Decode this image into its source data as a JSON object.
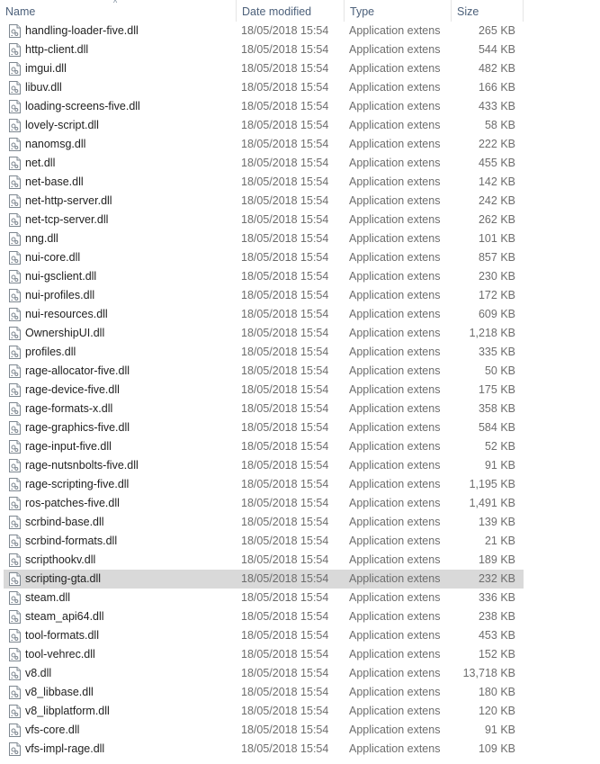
{
  "columns": {
    "name": "Name",
    "date": "Date modified",
    "type": "Type",
    "size": "Size"
  },
  "sort_indicator": "^",
  "icon": "dll-file-icon",
  "selected_index": 29,
  "files": [
    {
      "name": "handling-loader-five.dll",
      "date": "18/05/2018 15:54",
      "type": "Application extens",
      "size": "265 KB"
    },
    {
      "name": "http-client.dll",
      "date": "18/05/2018 15:54",
      "type": "Application extens",
      "size": "544 KB"
    },
    {
      "name": "imgui.dll",
      "date": "18/05/2018 15:54",
      "type": "Application extens",
      "size": "482 KB"
    },
    {
      "name": "libuv.dll",
      "date": "18/05/2018 15:54",
      "type": "Application extens",
      "size": "166 KB"
    },
    {
      "name": "loading-screens-five.dll",
      "date": "18/05/2018 15:54",
      "type": "Application extens",
      "size": "433 KB"
    },
    {
      "name": "lovely-script.dll",
      "date": "18/05/2018 15:54",
      "type": "Application extens",
      "size": "58 KB"
    },
    {
      "name": "nanomsg.dll",
      "date": "18/05/2018 15:54",
      "type": "Application extens",
      "size": "222 KB"
    },
    {
      "name": "net.dll",
      "date": "18/05/2018 15:54",
      "type": "Application extens",
      "size": "455 KB"
    },
    {
      "name": "net-base.dll",
      "date": "18/05/2018 15:54",
      "type": "Application extens",
      "size": "142 KB"
    },
    {
      "name": "net-http-server.dll",
      "date": "18/05/2018 15:54",
      "type": "Application extens",
      "size": "242 KB"
    },
    {
      "name": "net-tcp-server.dll",
      "date": "18/05/2018 15:54",
      "type": "Application extens",
      "size": "262 KB"
    },
    {
      "name": "nng.dll",
      "date": "18/05/2018 15:54",
      "type": "Application extens",
      "size": "101 KB"
    },
    {
      "name": "nui-core.dll",
      "date": "18/05/2018 15:54",
      "type": "Application extens",
      "size": "857 KB"
    },
    {
      "name": "nui-gsclient.dll",
      "date": "18/05/2018 15:54",
      "type": "Application extens",
      "size": "230 KB"
    },
    {
      "name": "nui-profiles.dll",
      "date": "18/05/2018 15:54",
      "type": "Application extens",
      "size": "172 KB"
    },
    {
      "name": "nui-resources.dll",
      "date": "18/05/2018 15:54",
      "type": "Application extens",
      "size": "609 KB"
    },
    {
      "name": "OwnershipUI.dll",
      "date": "18/05/2018 15:54",
      "type": "Application extens",
      "size": "1,218 KB"
    },
    {
      "name": "profiles.dll",
      "date": "18/05/2018 15:54",
      "type": "Application extens",
      "size": "335 KB"
    },
    {
      "name": "rage-allocator-five.dll",
      "date": "18/05/2018 15:54",
      "type": "Application extens",
      "size": "50 KB"
    },
    {
      "name": "rage-device-five.dll",
      "date": "18/05/2018 15:54",
      "type": "Application extens",
      "size": "175 KB"
    },
    {
      "name": "rage-formats-x.dll",
      "date": "18/05/2018 15:54",
      "type": "Application extens",
      "size": "358 KB"
    },
    {
      "name": "rage-graphics-five.dll",
      "date": "18/05/2018 15:54",
      "type": "Application extens",
      "size": "584 KB"
    },
    {
      "name": "rage-input-five.dll",
      "date": "18/05/2018 15:54",
      "type": "Application extens",
      "size": "52 KB"
    },
    {
      "name": "rage-nutsnbolts-five.dll",
      "date": "18/05/2018 15:54",
      "type": "Application extens",
      "size": "91 KB"
    },
    {
      "name": "rage-scripting-five.dll",
      "date": "18/05/2018 15:54",
      "type": "Application extens",
      "size": "1,195 KB"
    },
    {
      "name": "ros-patches-five.dll",
      "date": "18/05/2018 15:54",
      "type": "Application extens",
      "size": "1,491 KB"
    },
    {
      "name": "scrbind-base.dll",
      "date": "18/05/2018 15:54",
      "type": "Application extens",
      "size": "139 KB"
    },
    {
      "name": "scrbind-formats.dll",
      "date": "18/05/2018 15:54",
      "type": "Application extens",
      "size": "21 KB"
    },
    {
      "name": "scripthookv.dll",
      "date": "18/05/2018 15:54",
      "type": "Application extens",
      "size": "189 KB"
    },
    {
      "name": "scripting-gta.dll",
      "date": "18/05/2018 15:54",
      "type": "Application extens",
      "size": "232 KB"
    },
    {
      "name": "steam.dll",
      "date": "18/05/2018 15:54",
      "type": "Application extens",
      "size": "336 KB"
    },
    {
      "name": "steam_api64.dll",
      "date": "18/05/2018 15:54",
      "type": "Application extens",
      "size": "238 KB"
    },
    {
      "name": "tool-formats.dll",
      "date": "18/05/2018 15:54",
      "type": "Application extens",
      "size": "453 KB"
    },
    {
      "name": "tool-vehrec.dll",
      "date": "18/05/2018 15:54",
      "type": "Application extens",
      "size": "152 KB"
    },
    {
      "name": "v8.dll",
      "date": "18/05/2018 15:54",
      "type": "Application extens",
      "size": "13,718 KB"
    },
    {
      "name": "v8_libbase.dll",
      "date": "18/05/2018 15:54",
      "type": "Application extens",
      "size": "180 KB"
    },
    {
      "name": "v8_libplatform.dll",
      "date": "18/05/2018 15:54",
      "type": "Application extens",
      "size": "120 KB"
    },
    {
      "name": "vfs-core.dll",
      "date": "18/05/2018 15:54",
      "type": "Application extens",
      "size": "91 KB"
    },
    {
      "name": "vfs-impl-rage.dll",
      "date": "18/05/2018 15:54",
      "type": "Application extens",
      "size": "109 KB"
    }
  ]
}
